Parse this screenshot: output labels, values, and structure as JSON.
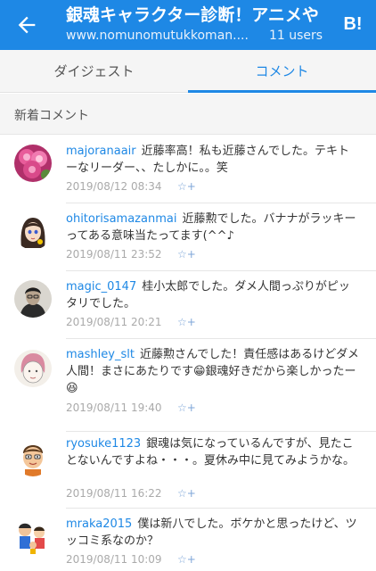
{
  "header": {
    "title": "銀魂キャラクター診断！アニメや",
    "url": "www.nomunomutukkoman....",
    "users": "11 users",
    "hatena_badge": "B!"
  },
  "tabs": [
    {
      "label": "ダイジェスト",
      "active": false
    },
    {
      "label": "コメント",
      "active": true
    }
  ],
  "section": {
    "title": "新着コメント"
  },
  "colors": {
    "accent": "#1e88e5"
  },
  "comments": [
    {
      "user": "majoranaair",
      "text": "近藤率高！私も近藤さんでした。テキトーなリーダー、、たしかに。。笑",
      "date": "2019/08/12 08:34",
      "star": "☆+",
      "avatar_icon": "pink-roses-avatar"
    },
    {
      "user": "ohitorisamazanmai",
      "text": "近藤勲でした。バナナがラッキーってある意味当たってます(^^♪",
      "date": "2019/08/11 23:52",
      "star": "☆+",
      "avatar_icon": "anime-girl-avatar"
    },
    {
      "user": "magic_0147",
      "text": "桂小太郎でした。ダメ人間っぷりがピッタリでした。",
      "date": "2019/08/11 20:21",
      "star": "☆+",
      "avatar_icon": "photo-man-avatar"
    },
    {
      "user": "mashley_slt",
      "text": "近藤勲さんでした！責任感はあるけどダメ人間！まさにあたりです😁銀魂好きだから楽しかったー😆",
      "date": "2019/08/11 19:40",
      "star": "☆+",
      "avatar_icon": "sketch-face-avatar"
    },
    {
      "user": "ryosuke1123",
      "text": "銀魂は気になっているんですが、見たことないんですよね・・・。夏休み中に見てみようかな。",
      "date": "2019/08/11 16:22",
      "star": "☆+",
      "avatar_icon": "cartoon-boy-avatar"
    },
    {
      "user": "mraka2015",
      "text": "僕は新八でした。ボケかと思ったけど、ツッコミ系なのか？",
      "date": "2019/08/11 10:09",
      "star": "☆+",
      "avatar_icon": "family-cartoon-avatar"
    }
  ]
}
